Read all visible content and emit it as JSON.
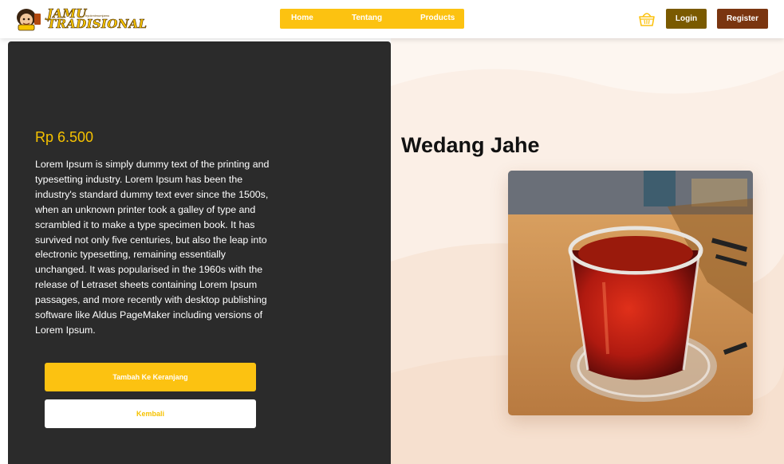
{
  "navbar": {
    "logo_text_line1": "JAMU",
    "logo_text_line2": "TRADISIONAL",
    "logo_subtext": "byukmimumjamu",
    "menu": [
      "Home",
      "Tentang",
      "Products"
    ],
    "login_label": "Login",
    "register_label": "Register",
    "cart_icon": "basket-icon"
  },
  "product": {
    "price": "Rp 6.500",
    "description": "Lorem Ipsum is simply dummy text of the printing and typesetting industry. Lorem Ipsum has been the industry's standard dummy text ever since the 1500s, when an unknown printer took a galley of type and scrambled it to make a type specimen book. It has survived not only five centuries, but also the leap into electronic typesetting, remaining essentially unchanged. It was popularised in the 1960s with the release of Letraset sheets containing Lorem Ipsum passages, and more recently with desktop publishing software like Aldus PageMaker including versions of Lorem Ipsum.",
    "name": "Wedang Jahe",
    "add_to_cart_label": "Tambah Ke Keranjang",
    "back_label": "Kembali"
  },
  "colors": {
    "accent_yellow": "#fcc211",
    "login_brown": "#7a5a00",
    "register_brown": "#7a3510",
    "dark_panel": "#2b2b2b",
    "right_bg": "#fbefe6"
  }
}
